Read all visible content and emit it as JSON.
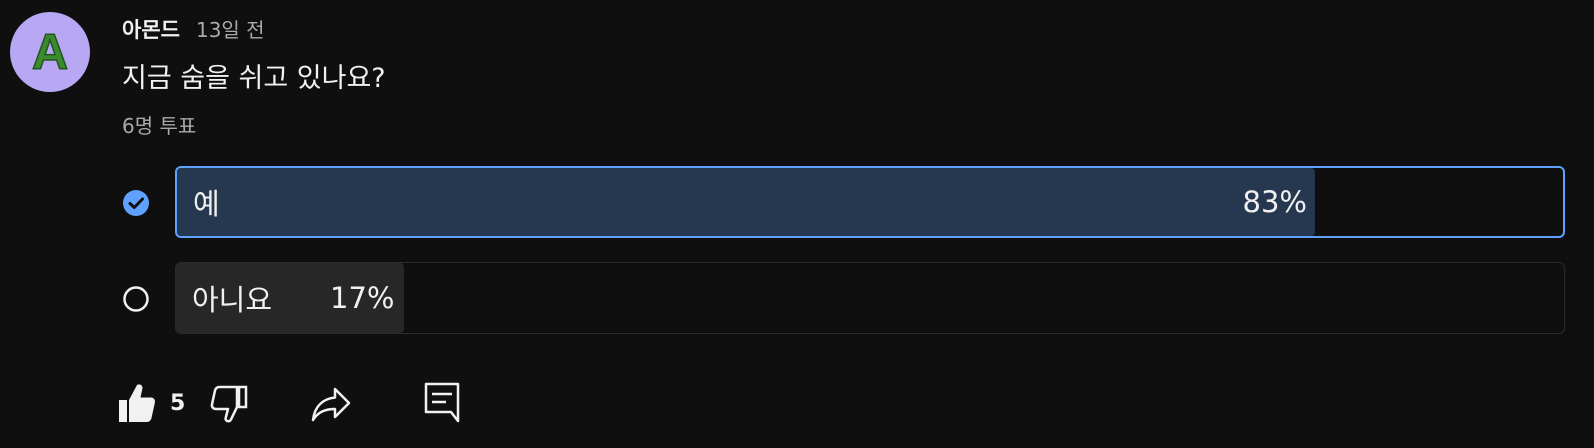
{
  "post": {
    "author": "아몬드",
    "time": "13일 전",
    "avatar_letter": "A",
    "avatar_bg": "#b8a7f2",
    "avatar_letter_color": "#3a8a2f"
  },
  "poll": {
    "question": "지금 숨을 쉬고 있나요?",
    "votes": "6명 투표",
    "accent_color": "#5ea1ff",
    "options": [
      {
        "label": "예",
        "percent_text": "83%",
        "percent": 83,
        "selected": true,
        "icon": "check-circle-icon"
      },
      {
        "label": "아니요",
        "percent_text": "17%",
        "percent": 17,
        "selected": false,
        "icon": "radio-circle-icon"
      }
    ]
  },
  "actions": {
    "like_count": "5",
    "like_icon": "thumbs-up-icon",
    "dislike_icon": "thumbs-down-icon",
    "share_icon": "share-icon",
    "comment_icon": "comment-icon"
  }
}
